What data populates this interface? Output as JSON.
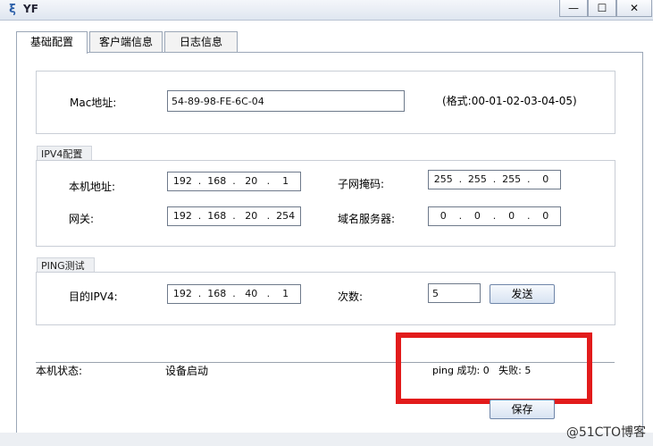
{
  "window": {
    "title": "YF",
    "minimize": "—",
    "maximize": "☐",
    "close": "✕"
  },
  "tabs": [
    {
      "label": "基础配置",
      "active": true
    },
    {
      "label": "客户端信息",
      "active": false
    },
    {
      "label": "日志信息",
      "active": false
    }
  ],
  "mac": {
    "label": "Mac地址:",
    "value": "54-89-98-FE-6C-04",
    "format_hint": "(格式:00-01-02-03-04-05)"
  },
  "ipv4": {
    "legend": "IPV4配置",
    "local_ip_label": "本机地址:",
    "local_ip": [
      "192",
      "168",
      "20",
      "1"
    ],
    "subnet_label": "子网掩码:",
    "subnet": [
      "255",
      "255",
      "255",
      "0"
    ],
    "gateway_label": "网关:",
    "gateway": [
      "192",
      "168",
      "20",
      "254"
    ],
    "dns_label": "域名服务器:",
    "dns": [
      "0",
      "0",
      "0",
      "0"
    ]
  },
  "ping": {
    "legend": "PING测试",
    "target_label": "目的IPV4:",
    "target": [
      "192",
      "168",
      "40",
      "1"
    ],
    "count_label": "次数:",
    "count": "5",
    "send_label": "发送"
  },
  "status": {
    "label": "本机状态:",
    "value": "设备启动",
    "ping_result": "ping 成功: 0   失败: 5"
  },
  "save_label": "保存",
  "watermark": "@51CTO博客",
  "colors": {
    "highlight_border": "#e21b1b",
    "accent": "#2a5ea8"
  }
}
